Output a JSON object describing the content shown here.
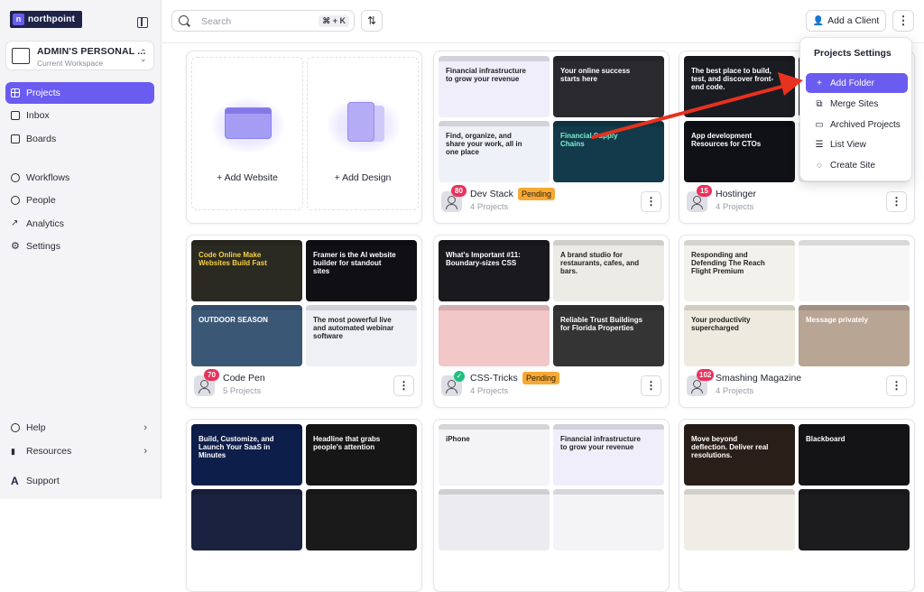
{
  "brand": {
    "name": "northpoint"
  },
  "workspace": {
    "title": "ADMIN'S PERSONAL ...",
    "subtitle": "Current Workspace"
  },
  "nav": {
    "main": [
      {
        "label": "Projects",
        "icon": "grid-icon",
        "active": true
      },
      {
        "label": "Inbox",
        "icon": "inbox-icon"
      },
      {
        "label": "Boards",
        "icon": "board-icon"
      },
      {
        "label": "Workflows",
        "icon": "workflow-icon"
      },
      {
        "label": "People",
        "icon": "person-icon"
      },
      {
        "label": "Analytics",
        "icon": "analytics-icon"
      },
      {
        "label": "Settings",
        "icon": "gear-icon"
      }
    ],
    "bottom": [
      {
        "label": "Help",
        "icon": "help-icon"
      },
      {
        "label": "Resources",
        "icon": "resources-icon"
      }
    ],
    "support": "Support"
  },
  "topbar": {
    "search_placeholder": "Search",
    "shortcut": "⌘ + K",
    "add_client": "Add a Client"
  },
  "add_cards": [
    {
      "label": "Add Website"
    },
    {
      "label": "Add Design"
    }
  ],
  "projects": [
    {
      "name": "Dev Stack",
      "sub": "4 Projects",
      "count": "80",
      "badge": "Pending",
      "thumbs": [
        {
          "text": "Financial infrastructure to grow your revenue",
          "bg": "#f1eefb",
          "color": "#222"
        },
        {
          "text": "Your online success starts here",
          "bg": "#2a2a2e",
          "color": "#fff"
        },
        {
          "text": "Find, organize, and share your work, all in one place",
          "bg": "#eef1f7",
          "color": "#222"
        },
        {
          "text": "Financial Supply Chains",
          "bg": "#123a4a",
          "color": "#7ff0d0"
        }
      ]
    },
    {
      "name": "Hostinger",
      "sub": "4 Projects",
      "count": "15",
      "thumbs": [
        {
          "text": "The best place to build, test, and discover front-end code.",
          "bg": "#1b1c22",
          "color": "#fff"
        },
        {
          "text": "",
          "bg": "#242428",
          "color": "#fff"
        },
        {
          "text": "App development Resources for CTOs",
          "bg": "#0f1116",
          "color": "#fff"
        },
        {
          "text": "",
          "bg": "#e9e9ee",
          "color": "#222"
        }
      ]
    },
    {
      "name": "Code Pen",
      "sub": "5 Projects",
      "count": "70",
      "thumbs": [
        {
          "text": "Code Online Make Websites Build Fast",
          "bg": "#2b2a22",
          "color": "#f5d047"
        },
        {
          "text": "Framer is the AI website builder for standout sites",
          "bg": "#0f0f14",
          "color": "#fff"
        },
        {
          "text": "OUTDOOR SEASON",
          "bg": "#3b5776",
          "color": "#fff"
        },
        {
          "text": "The most powerful live and automated webinar software",
          "bg": "#eef0f6",
          "color": "#222"
        }
      ]
    },
    {
      "name": "CSS-Tricks",
      "sub": "4 Projects",
      "badge": "Pending",
      "verified": true,
      "thumbs": [
        {
          "text": "What's Important #11: Boundary-sizes CSS",
          "bg": "#1a1a1e",
          "color": "#fff"
        },
        {
          "text": "A brand studio for restaurants, cafes, and bars.",
          "bg": "#ecebe6",
          "color": "#222"
        },
        {
          "text": "",
          "bg": "#f2c7c7",
          "color": "#222"
        },
        {
          "text": "Reliable Trust Buildings for Florida Properties",
          "bg": "#343434",
          "color": "#fff"
        }
      ]
    },
    {
      "name": "Smashing Magazine",
      "sub": "4 Projects",
      "count": "102",
      "thumbs": [
        {
          "text": "Responding and Defending The Reach Flight Premium",
          "bg": "#f3f1ec",
          "color": "#222"
        },
        {
          "text": "",
          "bg": "#f7f7f7",
          "color": "#222"
        },
        {
          "text": "Your productivity supercharged",
          "bg": "#efeadf",
          "color": "#222"
        },
        {
          "text": "Message privately",
          "bg": "#b9a594",
          "color": "#fff"
        }
      ]
    },
    {
      "name": "",
      "sub": "",
      "thumbs": [
        {
          "text": "Build, Customize, and Launch Your SaaS in Minutes",
          "bg": "#0e1e4a",
          "color": "#fff"
        },
        {
          "text": "Headline that grabs people's attention",
          "bg": "#161616",
          "color": "#fff"
        },
        {
          "text": "",
          "bg": "#1a2240",
          "color": "#fff"
        },
        {
          "text": "",
          "bg": "#1a1a1a",
          "color": "#fff"
        }
      ]
    },
    {
      "name": "",
      "sub": "",
      "thumbs": [
        {
          "text": "iPhone",
          "bg": "#f4f4f6",
          "color": "#222"
        },
        {
          "text": "Financial infrastructure to grow your revenue",
          "bg": "#f1eefb",
          "color": "#222"
        },
        {
          "text": "",
          "bg": "#ececf0",
          "color": "#222"
        },
        {
          "text": "",
          "bg": "#f4f4f6",
          "color": "#222"
        }
      ]
    },
    {
      "name": "",
      "sub": "",
      "thumbs": [
        {
          "text": "Move beyond deflection. Deliver real resolutions.",
          "bg": "#2a1e18",
          "color": "#fff"
        },
        {
          "text": "Blackboard",
          "bg": "#141416",
          "color": "#fff"
        },
        {
          "text": "",
          "bg": "#f0ece6",
          "color": "#222"
        },
        {
          "text": "",
          "bg": "#1c1c1e",
          "color": "#fff"
        }
      ]
    }
  ],
  "dropdown": {
    "title": "Projects Settings",
    "items": [
      {
        "label": "Add Folder",
        "icon": "plus-icon",
        "active": true
      },
      {
        "label": "Merge Sites",
        "icon": "merge-icon"
      },
      {
        "label": "Archived Projects",
        "icon": "archive-icon"
      },
      {
        "label": "List View",
        "icon": "list-icon"
      },
      {
        "label": "Create Site",
        "icon": "site-icon"
      }
    ]
  },
  "colors": {
    "accent": "#6a5cf0",
    "arrow": "#e8311e",
    "pending": "#f7a934",
    "count": "#e8325c"
  }
}
